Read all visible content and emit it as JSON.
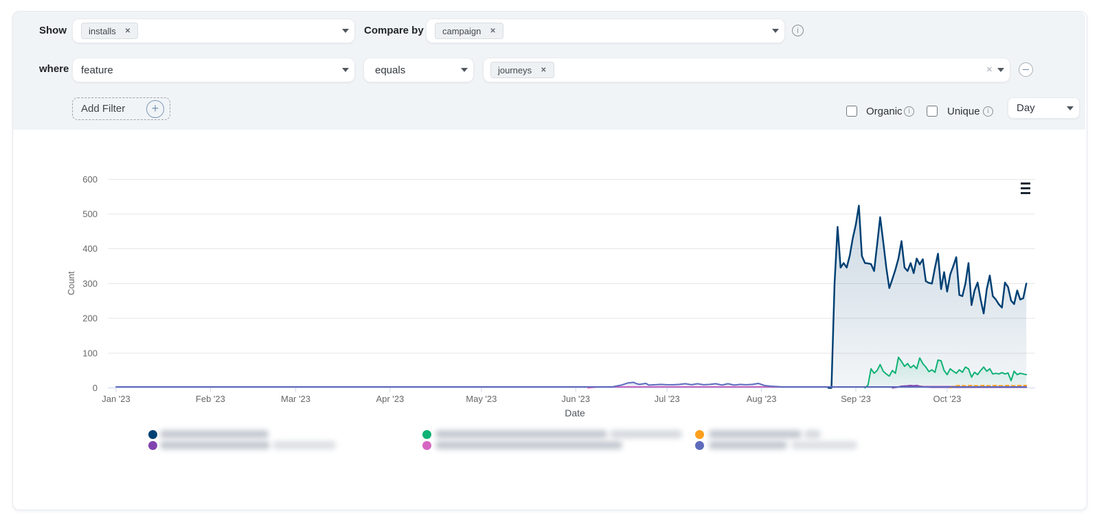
{
  "glyphs": {
    "close": "✕",
    "clear": "✕",
    "info": "i",
    "plus": "+"
  },
  "filter_bar": {
    "show_label": "Show",
    "show_chip": "installs",
    "compare_by_label": "Compare by",
    "compare_chip": "campaign",
    "where_label": "where",
    "property_value": "feature",
    "operator_value": "equals",
    "where_chip": "journeys",
    "add_filter_label": "Add Filter",
    "organic_label": "Organic",
    "unique_label": "Unique",
    "interval_value": "Day"
  },
  "chart_data": {
    "type": "area",
    "x_axis": {
      "title": "Date",
      "tick_labels": [
        "Jan '23",
        "Feb '23",
        "Mar '23",
        "Apr '23",
        "May '23",
        "Jun '23",
        "Jul '23",
        "Aug '23",
        "Sep '23",
        "Oct '23"
      ],
      "tick_days": [
        0,
        31,
        59,
        90,
        120,
        151,
        181,
        212,
        243,
        273
      ]
    },
    "y_axis": {
      "title": "Count",
      "ticks": [
        0,
        100,
        200,
        300,
        400,
        500,
        600
      ]
    },
    "series": [
      {
        "id": "series-1-label-blurred",
        "color": "#004073",
        "dash": "solid",
        "width": 2.5,
        "area": true,
        "fill_top": 0.2,
        "fill_bot": 0.05,
        "points": [
          [
            234,
            0
          ],
          [
            235,
            0
          ],
          [
            236,
            300
          ],
          [
            237,
            463
          ],
          [
            238,
            346
          ],
          [
            239,
            359
          ],
          [
            240,
            346
          ],
          [
            241,
            380
          ],
          [
            242,
            430
          ],
          [
            243,
            470
          ],
          [
            244,
            524
          ],
          [
            245,
            379
          ],
          [
            246,
            359
          ],
          [
            247,
            358
          ],
          [
            248,
            356
          ],
          [
            249,
            336
          ],
          [
            250,
            412
          ],
          [
            251,
            491
          ],
          [
            252,
            420
          ],
          [
            253,
            346
          ],
          [
            254,
            287
          ],
          [
            255,
            313
          ],
          [
            256,
            340
          ],
          [
            257,
            372
          ],
          [
            258,
            422
          ],
          [
            259,
            346
          ],
          [
            260,
            336
          ],
          [
            261,
            359
          ],
          [
            262,
            330
          ],
          [
            263,
            372
          ],
          [
            264,
            355
          ],
          [
            265,
            370
          ],
          [
            266,
            307
          ],
          [
            267,
            302
          ],
          [
            268,
            300
          ],
          [
            269,
            346
          ],
          [
            270,
            386
          ],
          [
            271,
            284
          ],
          [
            272,
            333
          ],
          [
            273,
            277
          ],
          [
            274,
            326
          ],
          [
            275,
            350
          ],
          [
            276,
            376
          ],
          [
            277,
            267
          ],
          [
            278,
            264
          ],
          [
            279,
            300
          ],
          [
            280,
            359
          ],
          [
            281,
            238
          ],
          [
            282,
            280
          ],
          [
            283,
            303
          ],
          [
            284,
            254
          ],
          [
            285,
            214
          ],
          [
            286,
            284
          ],
          [
            287,
            323
          ],
          [
            288,
            264
          ],
          [
            289,
            254
          ],
          [
            290,
            240
          ],
          [
            291,
            231
          ],
          [
            292,
            303
          ],
          [
            293,
            290
          ],
          [
            294,
            251
          ],
          [
            295,
            241
          ],
          [
            296,
            280
          ],
          [
            297,
            254
          ],
          [
            298,
            258
          ],
          [
            299,
            300
          ]
        ]
      },
      {
        "id": "series-3-label-blurred",
        "color": "#0fb174",
        "dash": "solid",
        "width": 2,
        "area": true,
        "fill_top": 0.15,
        "fill_bot": 0.04,
        "points": [
          [
            246,
            0
          ],
          [
            247,
            8
          ],
          [
            248,
            55
          ],
          [
            249,
            42
          ],
          [
            250,
            50
          ],
          [
            251,
            67
          ],
          [
            252,
            48
          ],
          [
            253,
            40
          ],
          [
            254,
            34
          ],
          [
            255,
            50
          ],
          [
            256,
            42
          ],
          [
            257,
            88
          ],
          [
            258,
            76
          ],
          [
            259,
            62
          ],
          [
            260,
            70
          ],
          [
            261,
            58
          ],
          [
            262,
            65
          ],
          [
            263,
            55
          ],
          [
            264,
            86
          ],
          [
            265,
            70
          ],
          [
            266,
            60
          ],
          [
            267,
            47
          ],
          [
            268,
            52
          ],
          [
            269,
            45
          ],
          [
            270,
            80
          ],
          [
            271,
            78
          ],
          [
            272,
            50
          ],
          [
            273,
            38
          ],
          [
            274,
            55
          ],
          [
            275,
            48
          ],
          [
            276,
            42
          ],
          [
            277,
            52
          ],
          [
            278,
            45
          ],
          [
            279,
            60
          ],
          [
            280,
            55
          ],
          [
            281,
            31
          ],
          [
            282,
            45
          ],
          [
            283,
            38
          ],
          [
            284,
            50
          ],
          [
            285,
            60
          ],
          [
            286,
            48
          ],
          [
            287,
            55
          ],
          [
            288,
            40
          ],
          [
            289,
            42
          ],
          [
            290,
            40
          ],
          [
            291,
            44
          ],
          [
            292,
            40
          ],
          [
            293,
            43
          ],
          [
            294,
            21
          ],
          [
            295,
            48
          ],
          [
            296,
            38
          ],
          [
            297,
            42
          ],
          [
            298,
            40
          ],
          [
            299,
            38
          ]
        ]
      },
      {
        "id": "series-2-label-blurred",
        "color": "#8242af",
        "dash": "solid",
        "width": 2,
        "area": false,
        "fill_top": 0,
        "fill_bot": 0,
        "points": [
          [
            255,
            0
          ],
          [
            257,
            3
          ],
          [
            258,
            5
          ],
          [
            260,
            6
          ],
          [
            261,
            7
          ],
          [
            262,
            6
          ],
          [
            263,
            7
          ],
          [
            264,
            5
          ],
          [
            265,
            4
          ],
          [
            266,
            3
          ],
          [
            268,
            2
          ],
          [
            270,
            2
          ],
          [
            275,
            2
          ],
          [
            280,
            2
          ],
          [
            285,
            2
          ],
          [
            290,
            2
          ],
          [
            295,
            2
          ],
          [
            299,
            2
          ]
        ]
      },
      {
        "id": "series-4-label-blurred",
        "color": "#d665c2",
        "dash": "solid",
        "width": 2,
        "area": false,
        "fill_top": 0,
        "fill_bot": 0,
        "points": [
          [
            155,
            0
          ],
          [
            158,
            3
          ],
          [
            162,
            3
          ],
          [
            170,
            3
          ],
          [
            180,
            3
          ],
          [
            190,
            3
          ],
          [
            200,
            3
          ],
          [
            210,
            3
          ],
          [
            219,
            3
          ],
          [
            230,
            3
          ],
          [
            240,
            3
          ],
          [
            250,
            3
          ],
          [
            258,
            3
          ],
          [
            262,
            3
          ],
          [
            266,
            4
          ],
          [
            270,
            4
          ],
          [
            274,
            4
          ],
          [
            278,
            3
          ],
          [
            282,
            3
          ],
          [
            286,
            3
          ],
          [
            290,
            3
          ],
          [
            295,
            3
          ],
          [
            299,
            3
          ]
        ]
      },
      {
        "id": "series-5-label-blurred",
        "color": "#fe9f1d",
        "dash": "dashed",
        "width": 2,
        "area": false,
        "fill_top": 0,
        "fill_bot": 0,
        "points": [
          [
            274,
            0
          ],
          [
            275,
            5
          ],
          [
            277,
            7
          ],
          [
            279,
            6
          ],
          [
            281,
            7
          ],
          [
            283,
            6
          ],
          [
            285,
            7
          ],
          [
            287,
            6
          ],
          [
            289,
            7
          ],
          [
            291,
            6
          ],
          [
            293,
            7
          ],
          [
            295,
            6
          ],
          [
            297,
            7
          ],
          [
            299,
            7
          ]
        ]
      },
      {
        "id": "series-6-label-blurred",
        "color": "#5e6bbc",
        "dash": "solid",
        "width": 2,
        "area": true,
        "fill_top": 0.18,
        "fill_bot": 0.1,
        "points": [
          [
            0,
            3
          ],
          [
            163,
            3
          ],
          [
            166,
            8
          ],
          [
            168,
            14
          ],
          [
            170,
            16
          ],
          [
            171,
            12
          ],
          [
            172,
            10
          ],
          [
            174,
            13
          ],
          [
            175,
            8
          ],
          [
            177,
            9
          ],
          [
            179,
            10
          ],
          [
            181,
            9
          ],
          [
            183,
            9
          ],
          [
            185,
            10
          ],
          [
            187,
            12
          ],
          [
            189,
            9
          ],
          [
            191,
            12
          ],
          [
            193,
            9
          ],
          [
            195,
            10
          ],
          [
            197,
            12
          ],
          [
            199,
            8
          ],
          [
            201,
            12
          ],
          [
            203,
            8
          ],
          [
            205,
            10
          ],
          [
            207,
            9
          ],
          [
            209,
            10
          ],
          [
            211,
            13
          ],
          [
            213,
            7
          ],
          [
            215,
            5
          ],
          [
            217,
            4
          ],
          [
            219,
            3
          ],
          [
            221,
            3
          ],
          [
            299,
            3
          ]
        ]
      }
    ]
  },
  "legend": {
    "labels_blurred": true,
    "entries": [
      {
        "id": "legend-1",
        "color": "#004073"
      },
      {
        "id": "legend-2",
        "color": "#8242af"
      },
      {
        "id": "legend-3",
        "color": "#0fb174"
      },
      {
        "id": "legend-4",
        "color": "#d665c2"
      },
      {
        "id": "legend-5",
        "color": "#fe9f1d"
      },
      {
        "id": "legend-6",
        "color": "#5e6bbc"
      }
    ]
  }
}
